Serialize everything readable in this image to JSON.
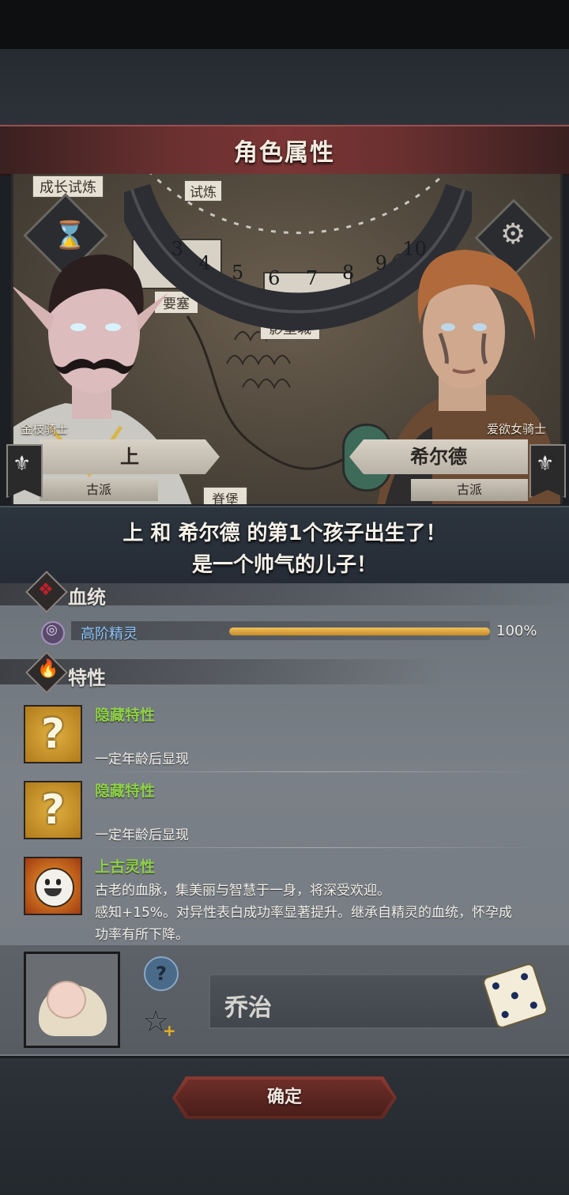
{
  "header": {
    "title": "角色属性"
  },
  "map": {
    "labels": [
      "成长试炼",
      "试炼",
      "要塞",
      "影壁城",
      "脊堡"
    ],
    "dial_numbers": [
      "3",
      "4",
      "5",
      "6",
      "7",
      "8",
      "9",
      "10"
    ]
  },
  "left_character": {
    "rank": "金枝骑士",
    "name": "上",
    "faction": "古派"
  },
  "right_character": {
    "rank": "爱欲女骑士",
    "name": "希尔德",
    "faction": "古派"
  },
  "message": {
    "line1": "上 和 希尔德 的第1个孩子出生了！",
    "line2": "是一个帅气的儿子！"
  },
  "bloodline": {
    "title": "血统",
    "race": "高阶精灵",
    "percent_label": "100%",
    "percent": 1.0
  },
  "traits": {
    "title": "特性",
    "items": [
      {
        "name": "隐藏特性",
        "desc": "一定年龄后显现",
        "icon": "question-icon"
      },
      {
        "name": "隐藏特性",
        "desc": "一定年龄后显现",
        "icon": "question-icon"
      },
      {
        "name": "上古灵性",
        "desc1": "古老的血脉，集美丽与智慧于一身，将深受欢迎。",
        "desc2": "感知+15%。对异性表白成功率显著提升。继承自精灵的血统，怀孕成",
        "desc3": "功率有所下降。",
        "icon": "smile-sun-icon"
      }
    ]
  },
  "child": {
    "name": "乔治"
  },
  "footer": {
    "confirm_label": "确定"
  },
  "colors": {
    "accent_red": "#7a3535",
    "trait_green": "#8fd04a",
    "bar_gold": "#d9a640"
  }
}
